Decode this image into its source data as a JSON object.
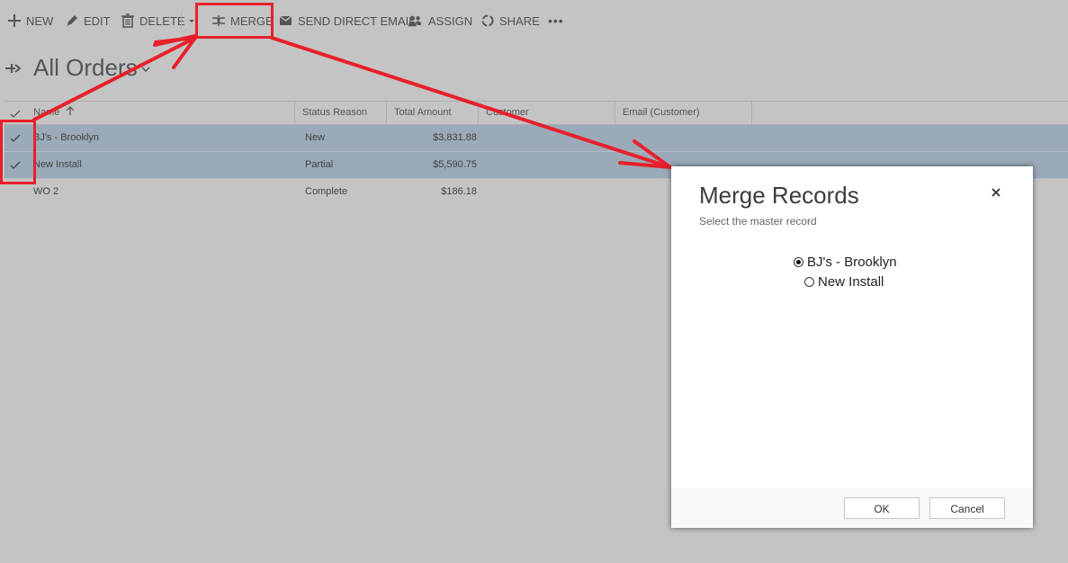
{
  "toolbar": {
    "new_label": "NEW",
    "edit_label": "EDIT",
    "delete_label": "DELETE",
    "merge_label": "MERGE",
    "email_label": "SEND DIRECT EMAIL",
    "assign_label": "ASSIGN",
    "share_label": "SHARE",
    "more_label": "•••"
  },
  "view": {
    "title": "All Orders"
  },
  "grid": {
    "columns": [
      "Name",
      "Status Reason",
      "Total Amount",
      "Customer",
      "Email (Customer)"
    ],
    "rows": [
      {
        "name": "BJ's - Brooklyn",
        "status": "New",
        "amount": "$3,831.88",
        "selected": true
      },
      {
        "name": "New Install",
        "status": "Partial",
        "amount": "$5,590.75",
        "selected": true
      },
      {
        "name": "WO 2",
        "status": "Complete",
        "amount": "$186.18",
        "selected": false
      }
    ]
  },
  "dialog": {
    "title": "Merge Records",
    "subtitle": "Select the master record",
    "options": [
      {
        "label": "BJ's - Brooklyn",
        "checked": true
      },
      {
        "label": "New Install",
        "checked": false
      }
    ],
    "ok_label": "OK",
    "cancel_label": "Cancel"
  },
  "colors": {
    "background": "#c4c4c4",
    "selected_row": "#9aaab8",
    "annotation_red": "#e8202b"
  }
}
